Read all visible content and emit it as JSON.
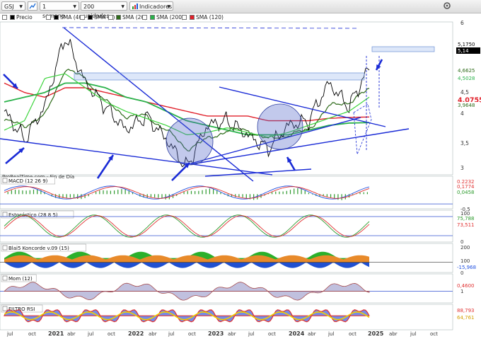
{
  "toolbar": {
    "symbol": "GSJ",
    "timeframe": "1 semana",
    "units": "200 unidades",
    "indicators_label": "Indicadores",
    "icons": [
      "chart-type-icon",
      "dropdown-caret-icon",
      "indicator-icon",
      "settings-icon"
    ]
  },
  "legend": [
    {
      "label": "Precio",
      "color": "#000000"
    },
    {
      "label": "SMA (40)",
      "color": "#000000"
    },
    {
      "label": "SMA (4)",
      "color": "#000000"
    },
    {
      "label": "SMA (20)",
      "color": "#2e6b1a"
    },
    {
      "label": "SMA (200)",
      "color": "#29b24a"
    },
    {
      "label": "SMA (120)",
      "color": "#e0202a"
    }
  ],
  "watermark": "ProRealTime.com - Fin de Día",
  "price_scale": {
    "ticks": [
      "6",
      "5,5",
      "5",
      "4,5",
      "4",
      "3,5",
      "3"
    ],
    "labels": [
      {
        "text": "5,1750",
        "bg": "#ffffff",
        "fg": "#000000"
      },
      {
        "text": "5,14",
        "bg": "#000000",
        "fg": "#ffffff"
      },
      {
        "text": "4,6625",
        "bg": "#ffffff",
        "fg": "#2e6b1a"
      },
      {
        "text": "4,5028",
        "bg": "#ffffff",
        "fg": "#29b24a"
      },
      {
        "text": "4,0755",
        "bg": "#ffffff",
        "fg": "#e0202a"
      },
      {
        "text": "3,9648",
        "bg": "#ffffff",
        "fg": "#2e6b1a"
      }
    ]
  },
  "panels": [
    {
      "title": "MACD (12 26 9)",
      "ticks": [
        "0,5",
        "-0,5"
      ],
      "labels": [
        "0,2232",
        "0,1774",
        "0,0458"
      ]
    },
    {
      "title": "Estocástico (28 8 5)",
      "ticks": [
        "100",
        "0"
      ],
      "labels": [
        "75,788",
        "73,511"
      ]
    },
    {
      "title": "Blai5 Koncorde v.09 (15)",
      "ticks": [
        "200",
        "100",
        "0"
      ],
      "labels": [
        "-15,968"
      ]
    },
    {
      "title": "Mom (12)",
      "ticks": [
        "1"
      ],
      "labels": [
        "0,4600"
      ]
    },
    {
      "title": "FILTRO RSI",
      "ticks": [
        "100"
      ],
      "labels": [
        "88,793",
        "64,761"
      ]
    }
  ],
  "x_axis": [
    "jul",
    "oct",
    "2021",
    "abr",
    "jul",
    "oct",
    "2022",
    "abr",
    "jul",
    "oct",
    "2023",
    "abr",
    "jul",
    "oct",
    "2024",
    "abr",
    "jul",
    "oct",
    "2025",
    "abr",
    "jul",
    "oct"
  ],
  "colors": {
    "trendline": "#1a2bd6",
    "macd": "#2050e0",
    "signal": "#e03030",
    "hist": "#2e9a2e"
  },
  "chart_data": {
    "type": "line",
    "x": [
      "2020-07",
      "2020-10",
      "2021-01",
      "2021-04",
      "2021-07",
      "2021-10",
      "2022-01",
      "2022-04",
      "2022-07",
      "2022-10",
      "2023-01",
      "2023-04",
      "2023-07",
      "2023-10",
      "2024-01",
      "2024-04",
      "2024-07",
      "2024-10",
      "2025-01"
    ],
    "series": [
      {
        "name": "Precio",
        "values": [
          4.2,
          3.6,
          4.3,
          5.8,
          4.8,
          4.3,
          3.8,
          4.1,
          3.6,
          3.0,
          3.9,
          4.0,
          3.7,
          3.4,
          3.9,
          4.0,
          4.8,
          4.3,
          5.14
        ]
      },
      {
        "name": "SMA (20)",
        "values": [
          4.0,
          3.9,
          4.1,
          5.1,
          4.9,
          4.4,
          4.1,
          4.1,
          3.8,
          3.4,
          3.6,
          3.8,
          3.8,
          3.6,
          3.7,
          3.8,
          4.3,
          4.4,
          4.66
        ]
      },
      {
        "name": "SMA (200)",
        "values": [
          4.4,
          4.5,
          4.6,
          4.8,
          4.8,
          4.7,
          4.5,
          4.4,
          4.2,
          4.0,
          3.9,
          3.8,
          3.7,
          3.7,
          3.7,
          3.8,
          3.9,
          3.95,
          3.96
        ]
      },
      {
        "name": "SMA (120)",
        "values": [
          4.8,
          4.6,
          4.5,
          4.7,
          4.7,
          4.6,
          4.5,
          4.4,
          4.3,
          4.2,
          4.1,
          4.1,
          4.1,
          4.0,
          4.0,
          4.0,
          4.05,
          4.07,
          4.08
        ]
      }
    ],
    "ylim": [
      2.85,
      6.1
    ]
  }
}
